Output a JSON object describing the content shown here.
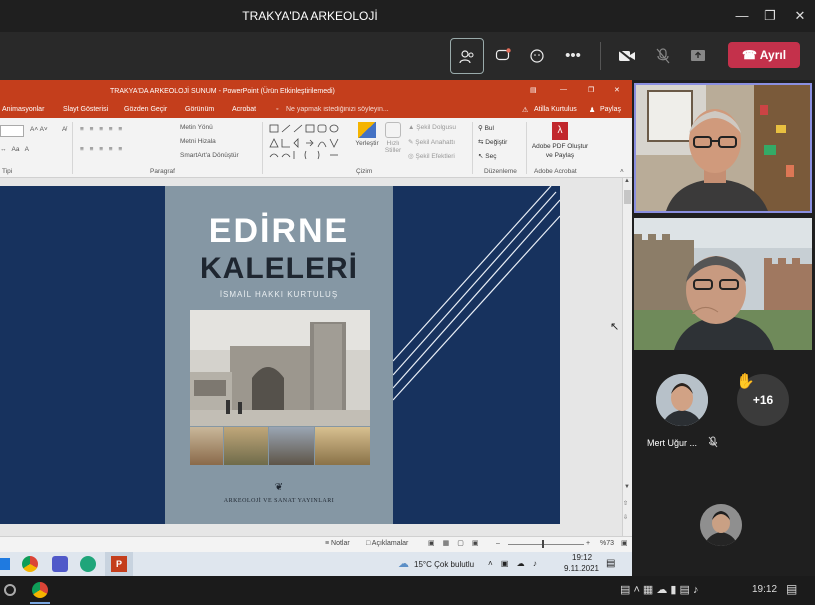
{
  "window": {
    "title": "TRAKYA'DA ARKEOLOJİ",
    "minimize_icon": "minimize-icon",
    "maximize_icon": "maximize-icon",
    "close_icon": "close-icon"
  },
  "meeting_controls": {
    "participants_icon": "people-icon",
    "chat_icon": "chat-icon",
    "reactions_icon": "reaction-icon",
    "more_icon": "more-icon",
    "camera_icon": "camera-off-icon",
    "mic_icon": "mic-off-icon",
    "share_icon": "share-icon",
    "leave_label": "Ayrıl",
    "leave_color": "#c4314b"
  },
  "powerpoint": {
    "title": "TRAKYA'DA ARKEOLOJİ SUNUM - PowerPoint (Ürün Etkinleştirilemedi)",
    "tabs": [
      "Animasyonlar",
      "Slayt Gösterisi",
      "Gözden Geçir",
      "Görünüm",
      "Acrobat"
    ],
    "search_hint": "Ne yapmak istediğinizi söyleyin...",
    "user": "Atilla Kurtulus",
    "share": "Paylaş",
    "ribbon": {
      "text_direction": "Metin Yönü",
      "align_text": "Metni Hizala",
      "smartart": "SmartArt'a Dönüştür",
      "arrange": "Yerleştir",
      "quick_styles": "Hızlı Stiller",
      "shape_fill": "Şekil Dolgusu",
      "shape_outline": "Şekil Anahattı",
      "shape_effects": "Şekil Efektleri",
      "find": "Bul",
      "replace": "Değiştir",
      "select": "Seç",
      "adobe": "Adobe PDF Oluştur ve Paylaş",
      "groups": [
        "Tipi",
        "Paragraf",
        "Çizim",
        "Düzenleme",
        "Adobe Acrobat"
      ]
    },
    "slide": {
      "title_line1": "EDİRNE",
      "title_line2": "KALELERİ",
      "author": "İSMAİL HAKKI KURTULUŞ",
      "publisher": "ARKEOLOJİ VE SANAT YAYINLARI",
      "background_color": "#17325e",
      "cover_color": "#8597a4"
    },
    "status": {
      "notes": "Notlar",
      "comments": "Açıklamalar",
      "zoom": "%73"
    }
  },
  "inner_taskbar": {
    "weather": "15°C  Çok bulutlu",
    "time": "19:12",
    "date": "9.11.2021"
  },
  "participants": {
    "names": [
      "Mert Uğur ..."
    ],
    "overflow_count": "+16",
    "raised_hand_icon": "raised-hand-icon",
    "mic_off_icon": "mic-off-icon"
  },
  "taskbar": {
    "time": "19:12",
    "start_icon": "windows-icon",
    "chrome_icon": "chrome-icon"
  }
}
